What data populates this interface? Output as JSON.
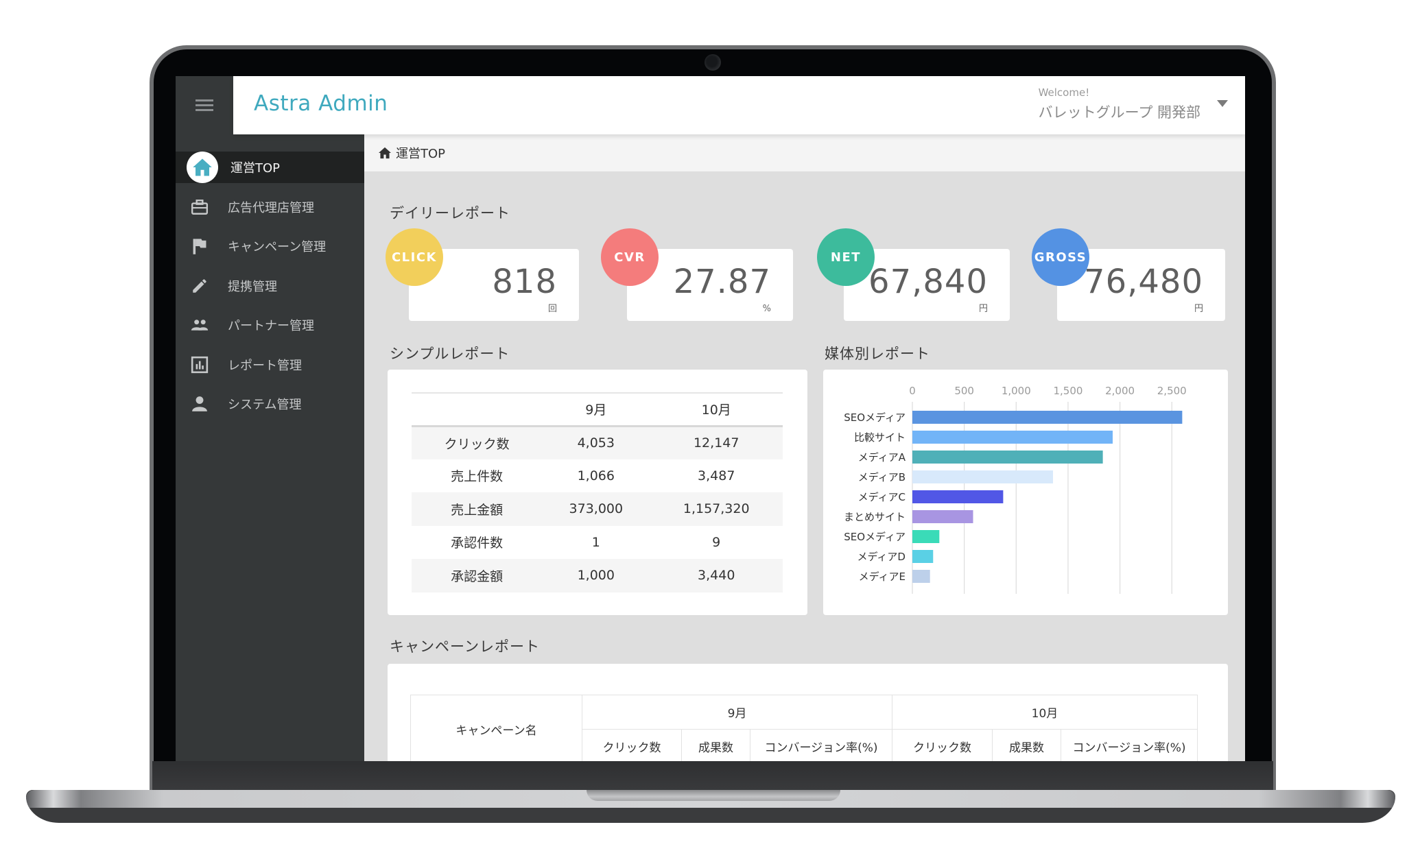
{
  "app": {
    "title": "Astra Admin"
  },
  "header": {
    "welcome": "Welcome!",
    "user_name": "バレットグループ 開発部"
  },
  "sidebar": {
    "items": [
      {
        "label": "運営TOP",
        "icon": "home-icon",
        "active": true
      },
      {
        "label": "広告代理店管理",
        "icon": "briefcase-icon"
      },
      {
        "label": "キャンペーン管理",
        "icon": "flag-icon"
      },
      {
        "label": "提携管理",
        "icon": "pencil-icon"
      },
      {
        "label": "パートナー管理",
        "icon": "people-icon"
      },
      {
        "label": "レポート管理",
        "icon": "report-chart-icon"
      },
      {
        "label": "システム管理",
        "icon": "person-icon"
      }
    ]
  },
  "breadcrumb": {
    "label": "運営TOP"
  },
  "daily_report": {
    "title": "デイリーレポート",
    "cards": [
      {
        "badge": "CLICK",
        "value": "818",
        "unit": "回",
        "color": "#f2cf5b"
      },
      {
        "badge": "CVR",
        "value": "27.87",
        "unit": "%",
        "color": "#f47c7c"
      },
      {
        "badge": "NET",
        "value": "67,840",
        "unit": "円",
        "color": "#3dbb9c"
      },
      {
        "badge": "GROSS",
        "value": "76,480",
        "unit": "円",
        "color": "#5492e3"
      }
    ]
  },
  "simple_report": {
    "title": "シンプルレポート",
    "columns": [
      "",
      "9月",
      "10月"
    ],
    "rows": [
      [
        "クリック数",
        "4,053",
        "12,147"
      ],
      [
        "売上件数",
        "1,066",
        "3,487"
      ],
      [
        "売上金額",
        "373,000",
        "1,157,320"
      ],
      [
        "承認件数",
        "1",
        "9"
      ],
      [
        "承認金額",
        "1,000",
        "3,440"
      ]
    ]
  },
  "media_report": {
    "title": "媒体別レポート"
  },
  "chart_data": {
    "type": "bar",
    "orientation": "horizontal",
    "title": "媒体別レポート",
    "xlabel": "",
    "ylabel": "",
    "xlim": [
      0,
      2500
    ],
    "xticks": [
      0,
      500,
      1000,
      1500,
      2000,
      2500
    ],
    "xtick_labels": [
      "0",
      "500",
      "1,000",
      "1,500",
      "2,000",
      "2,500"
    ],
    "grid": true,
    "legend": "none",
    "categories": [
      "SEOメディア",
      "比較サイト",
      "メディアA",
      "メディアB",
      "メディアC",
      "まとめサイト",
      "SEOメディア",
      "メディアD",
      "メディアE"
    ],
    "values": [
      2600,
      1930,
      1835,
      1355,
      875,
      585,
      260,
      200,
      170
    ],
    "colors": [
      "#5a94e0",
      "#72b4f7",
      "#4fb0b8",
      "#d8e9fb",
      "#5157e6",
      "#a895e2",
      "#3adbb8",
      "#5ad0e5",
      "#bdd0ea"
    ]
  },
  "campaign_report": {
    "title": "キャンペーンレポート",
    "name_header": "キャンペーン名",
    "months": [
      "9月",
      "10月"
    ],
    "sub_headers": [
      "クリック数",
      "成果数",
      "コンバージョン率(%)"
    ]
  }
}
